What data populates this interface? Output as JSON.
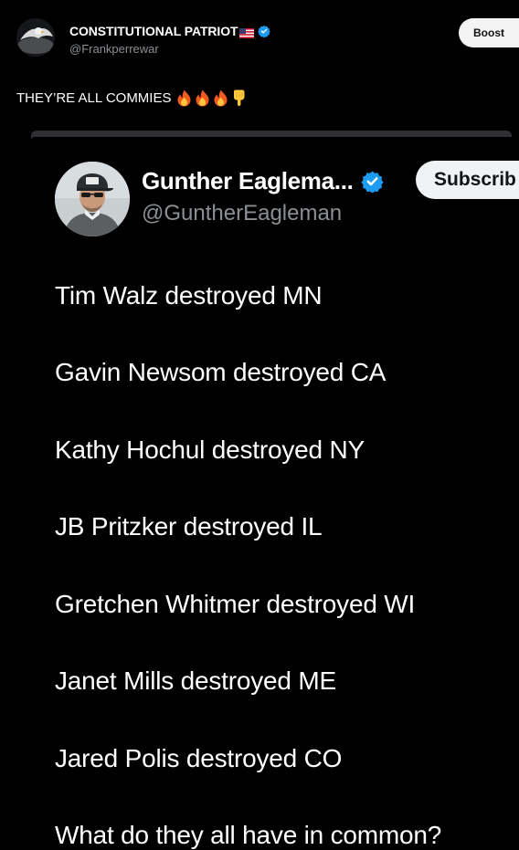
{
  "post": {
    "author_name": "CONSTITUTIONAL PATRIOT",
    "author_handle": "@Frankperrewar",
    "boost_label": "Boost",
    "text": "THEY’RE ALL COMMIES",
    "icons": {
      "avatar": "eagle-avatar-icon",
      "flag": "us-flag-icon",
      "verified": "verified-badge-icon",
      "emojis": [
        "fire-icon",
        "fire-icon",
        "fire-icon",
        "pointing-down-icon"
      ]
    }
  },
  "embedded_post": {
    "author_name": "Gunther Eaglema...",
    "author_handle": "@GuntherEagleman",
    "subscribe_label": "Subscrib",
    "lines": [
      "Tim Walz destroyed MN",
      "Gavin Newsom destroyed CA",
      "Kathy Hochul destroyed NY",
      "JB Pritzker destroyed IL",
      "Gretchen Whitmer destroyed WI",
      "Janet Mills destroyed ME",
      "Jared Polis destroyed CO",
      "What do they all have in common?"
    ]
  },
  "colors": {
    "background": "#000000",
    "text": "#ffffff",
    "muted": "#8b8f94",
    "verified": "#1d9bf0",
    "button_bg": "#eff3f4"
  }
}
